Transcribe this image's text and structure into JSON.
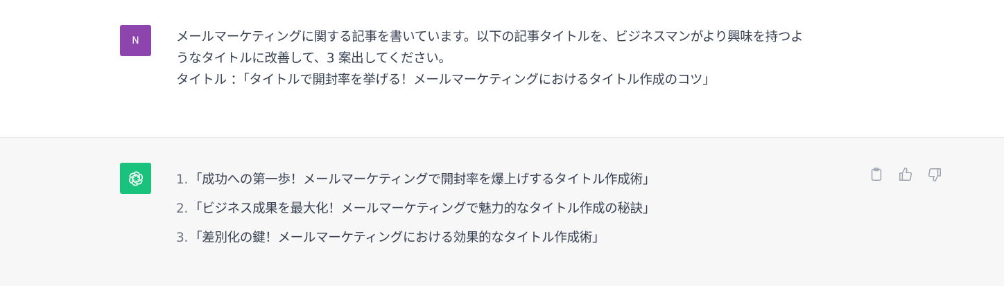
{
  "user_message": {
    "avatar_initial": "N",
    "avatar_color": "#8e44ad",
    "lines": [
      "メールマーケティングに関する記事を書いています。以下の記事タイトルを、ビジネスマンがより興味を持つよ",
      "うなタイトルに改善して、3 案出してください。",
      "タイトル ：「タイトルで開封率を挙げる！メールマーケティングにおけるタイトル作成のコツ」"
    ]
  },
  "assistant_message": {
    "avatar_icon": "openai-logo-icon",
    "avatar_color": "#19c37d",
    "items": [
      {
        "num": "1.",
        "text": "「成功への第一歩！メールマーケティングで開封率を爆上げするタイトル作成術」"
      },
      {
        "num": "2.",
        "text": "「ビジネス成果を最大化！メールマーケティングで魅力的なタイトル作成の秘訣」"
      },
      {
        "num": "3.",
        "text": "「差別化の鍵！メールマーケティングにおける効果的なタイトル作成術」"
      }
    ],
    "actions": [
      "clipboard-icon",
      "thumbs-up-icon",
      "thumbs-down-icon"
    ]
  }
}
